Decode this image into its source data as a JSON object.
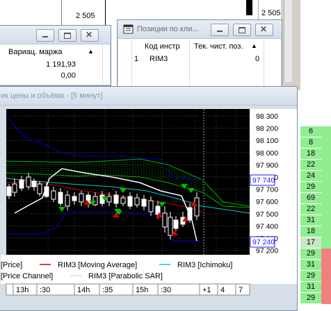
{
  "background_chart": {
    "tick_label": "2 505",
    "price_label": "2 505,1"
  },
  "left_window": {
    "column_header": "Вариац. маржа",
    "values": [
      "1 191,93",
      "0,00"
    ]
  },
  "positions_window": {
    "title": "Позиции по кли...",
    "columns": [
      "Код инстр",
      "Тек. чист. поз."
    ],
    "rows": [
      {
        "num": "1",
        "code": "RIM3",
        "position": "0"
      }
    ]
  },
  "chart_window": {
    "title": "ик цены и объёма - [5 минут]",
    "y_ticks": [
      "98 300",
      "98 200",
      "98 100",
      "98 000",
      "97 900",
      "97 800",
      "97 700",
      "97 600",
      "97 500",
      "97 400",
      "97 300",
      "97 200"
    ],
    "price_tags": [
      "97 740",
      "97 240"
    ],
    "legend": [
      "[Price]",
      "RIM3 [Moving Average]",
      "RIM3 [Ichimoku]",
      "[Price Channel]",
      "RIM3 [Parabolic SAR]"
    ],
    "time_labels": [
      "13h",
      ":30",
      "14h",
      ":35",
      "15h",
      ":30",
      "+1",
      "4",
      "7"
    ],
    "colors": {
      "price_channel": "#0000cc",
      "moving_average": "#cc0000",
      "ichimoku": "#00cccc",
      "cloud": "#00aa00",
      "sar": "#ffffff",
      "buy_marker": "#00bb00",
      "sell_marker": "#dd0000"
    }
  },
  "order_book": {
    "values": [
      "6",
      "8",
      "18",
      "22",
      "24",
      "29",
      "69",
      "22",
      "31",
      "18",
      "17",
      "29",
      "31",
      "29",
      "31",
      "29"
    ],
    "highlighted_index": 10,
    "colors": {
      "normal": "#90ee90",
      "highlight": "#c7e8c7",
      "right_pink": "#f08080"
    }
  }
}
